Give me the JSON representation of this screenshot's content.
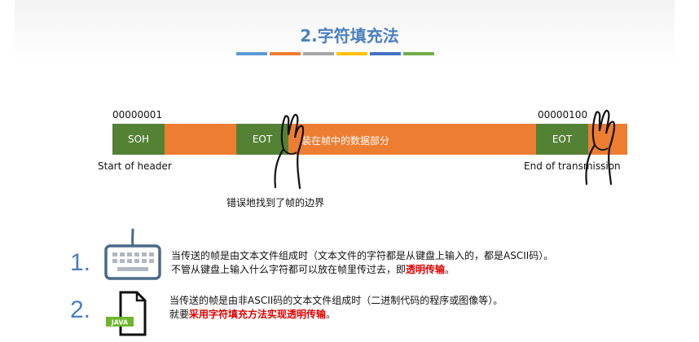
{
  "slide": {
    "title": "2.字符填充法",
    "title_bar_colors": [
      "#5b9bd5",
      "#ed7d31",
      "#a5a5a5",
      "#ffc000",
      "#4472c4",
      "#70ad47"
    ]
  },
  "frame_diagram": {
    "soh_code": "00000001",
    "eot_code": "00000100",
    "soh_label": "SOH",
    "eot_label": "EOT",
    "data_label": "装在帧中的数据部分",
    "start_caption": "Start of header",
    "end_caption": "End of transmission",
    "error_caption": "错误地找到了帧的边界",
    "colors": {
      "frame": "#ed7d31",
      "field": "#548235"
    }
  },
  "list": [
    {
      "number": "1.",
      "icon": "keyboard-icon",
      "line1": "当传送的帧是由文本文件组成时（文本文件的字符都是从键盘上输入的，都是ASCII码）。",
      "line2_pre": "不管从键盘上输入什么字符都可以放在帧里传过去，即",
      "line2_hl": "透明传输",
      "line2_post": "。"
    },
    {
      "number": "2.",
      "icon": "java-file-icon",
      "icon_badge": "JAVA",
      "line1": "当传送的帧是由非ASCII码的文本文件组成时（二进制代码的程序或图像等）。",
      "line2_pre": "就要",
      "line2_hl": "采用字符填充方法实现透明传输",
      "line2_post": "。"
    }
  ]
}
